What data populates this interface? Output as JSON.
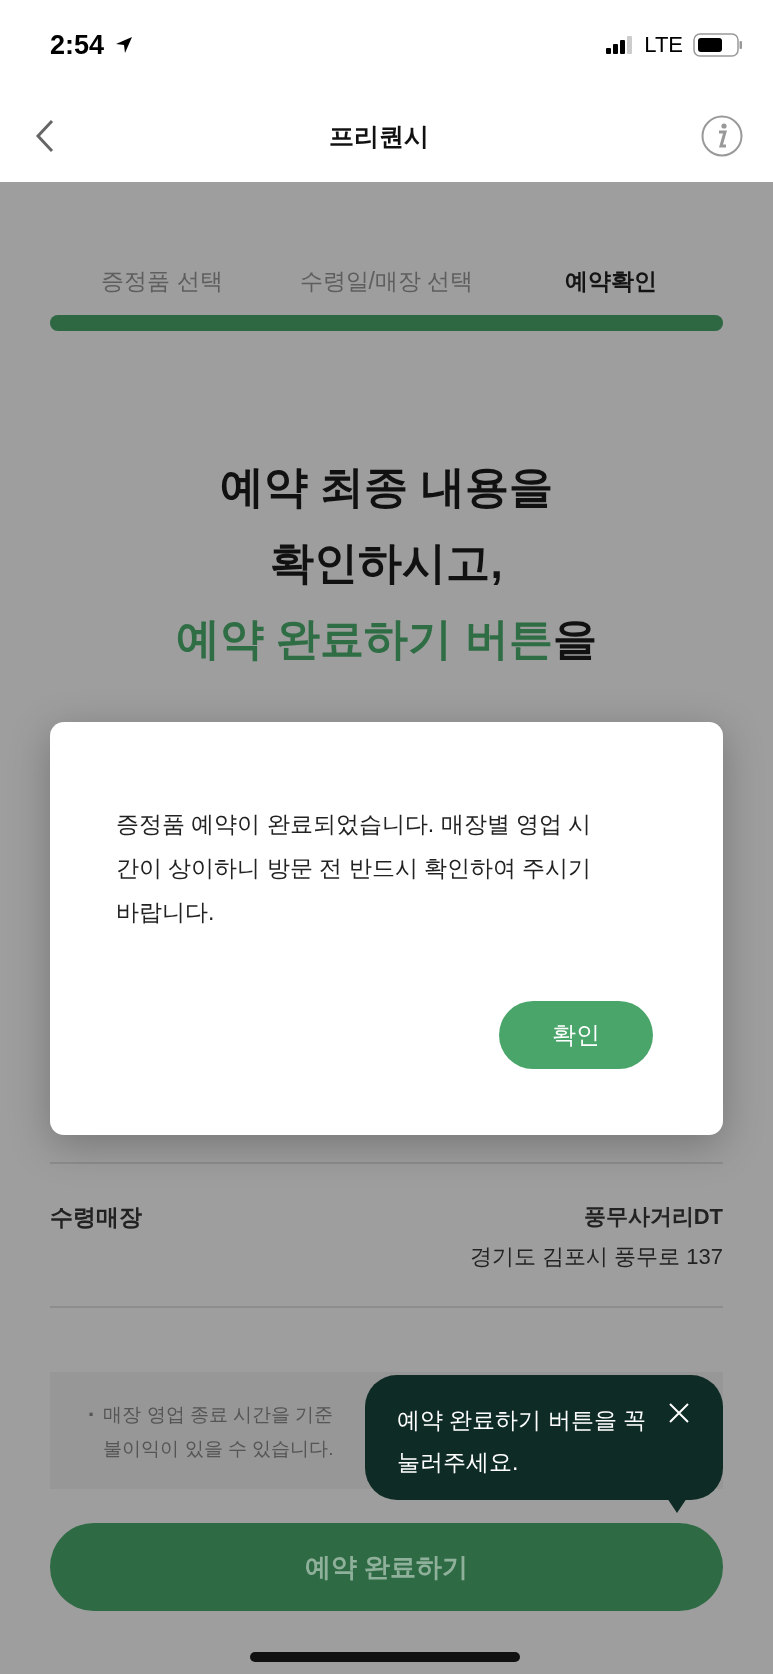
{
  "status_bar": {
    "time": "2:54",
    "network": "LTE"
  },
  "nav": {
    "title": "프리퀀시"
  },
  "steps": [
    {
      "label": "증정품 선택",
      "selected": false
    },
    {
      "label": "수령일/매장 선택",
      "selected": false
    },
    {
      "label": "예약확인",
      "selected": true
    }
  ],
  "progress": {
    "level": 1
  },
  "headline": [
    [
      {
        "text": "예약 최종 내용을",
        "highlight": false
      }
    ],
    [
      {
        "text": "확인하시고,",
        "highlight": false
      }
    ],
    [
      {
        "text": "예약 완료하기 버튼",
        "highlight": true
      },
      {
        "text": "을",
        "highlight": false
      }
    ]
  ],
  "details": [
    {
      "label": "수령매장",
      "values": [
        "풍무사거리DT",
        "경기도 김포시 풍무로 137"
      ]
    }
  ],
  "notice": {
    "bullet": "·",
    "lines": [
      "매장 영업 종료 시간을 기준",
      "불이익이 있을 수 있습니다."
    ]
  },
  "tooltip": {
    "text": "예약 완료하기 버튼을 꼭 눌러주세요."
  },
  "submit_button": {
    "label": "예약 완료하기"
  },
  "dialog": {
    "message": "증정품 예약이 완료되었습니다. 매장별 영업 시간이 상이하니 방문 전 반드시 확인하여 주시기 바랍니다.",
    "button": "확인"
  }
}
